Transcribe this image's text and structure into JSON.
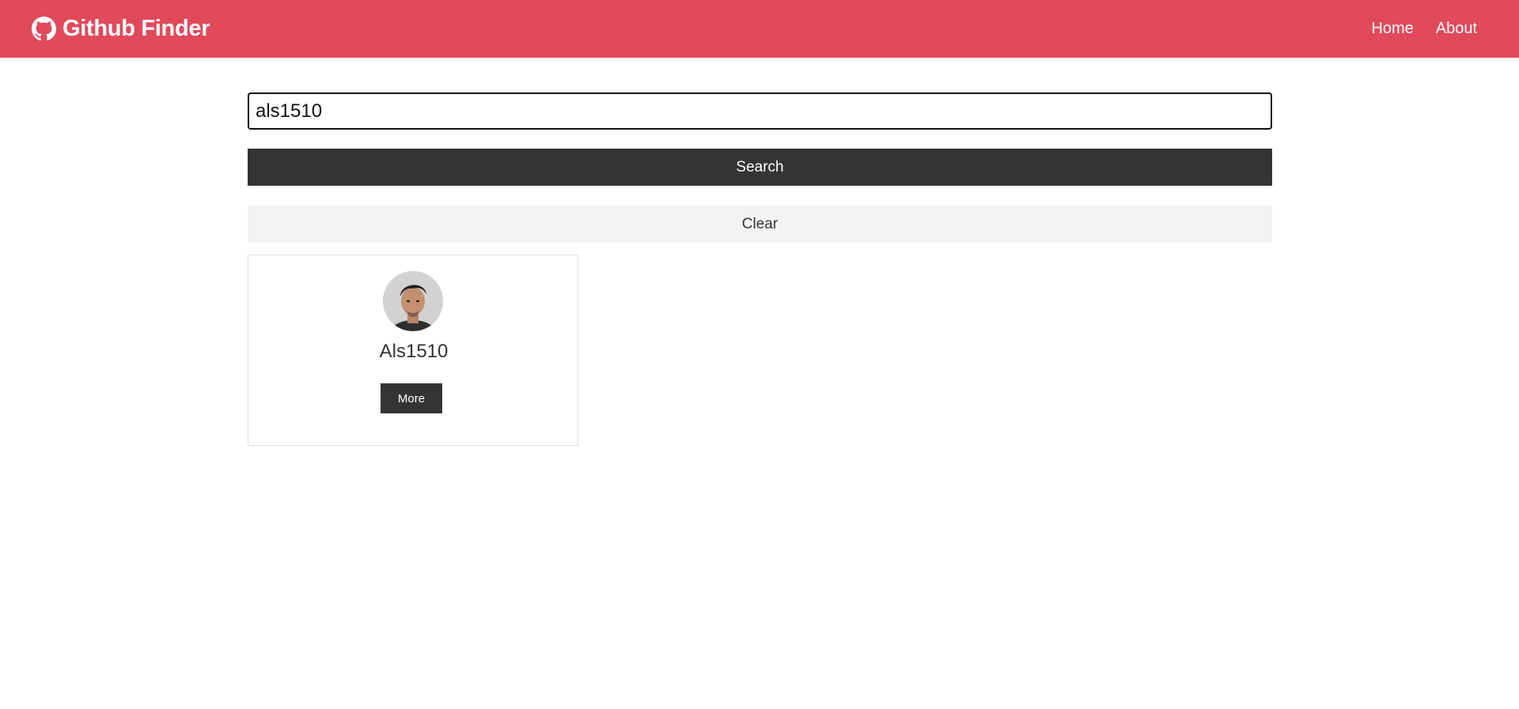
{
  "navbar": {
    "brand_icon": "github-icon",
    "title": "Github Finder",
    "links": [
      {
        "label": "Home"
      },
      {
        "label": "About"
      }
    ],
    "background_color": "#e04a5b"
  },
  "search": {
    "value": "als1510",
    "search_label": "Search",
    "clear_label": "Clear"
  },
  "results": [
    {
      "username": "Als1510",
      "more_label": "More"
    }
  ]
}
